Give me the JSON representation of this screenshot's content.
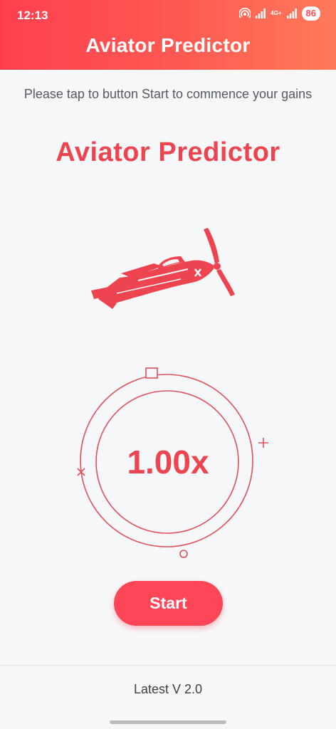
{
  "status_bar": {
    "time": "12:13",
    "network_label": "4G+",
    "battery": "86",
    "icons": [
      "hotspot-icon",
      "signal-icon",
      "signal-icon",
      "battery-icon"
    ]
  },
  "app_bar": {
    "title": "Aviator Predictor"
  },
  "main": {
    "instructions": "Please tap to button Start to commence your gains",
    "headline": "Aviator Predictor",
    "multiplier": "1.00x",
    "start_label": "Start"
  },
  "footer": {
    "version": "Latest V 2.0"
  },
  "colors": {
    "accent": "#ee4450",
    "header_gradient_start": "#ff3f4f",
    "header_gradient_end": "#ff7a5a",
    "button": "#ff4656",
    "background": "#f6f7f9"
  }
}
